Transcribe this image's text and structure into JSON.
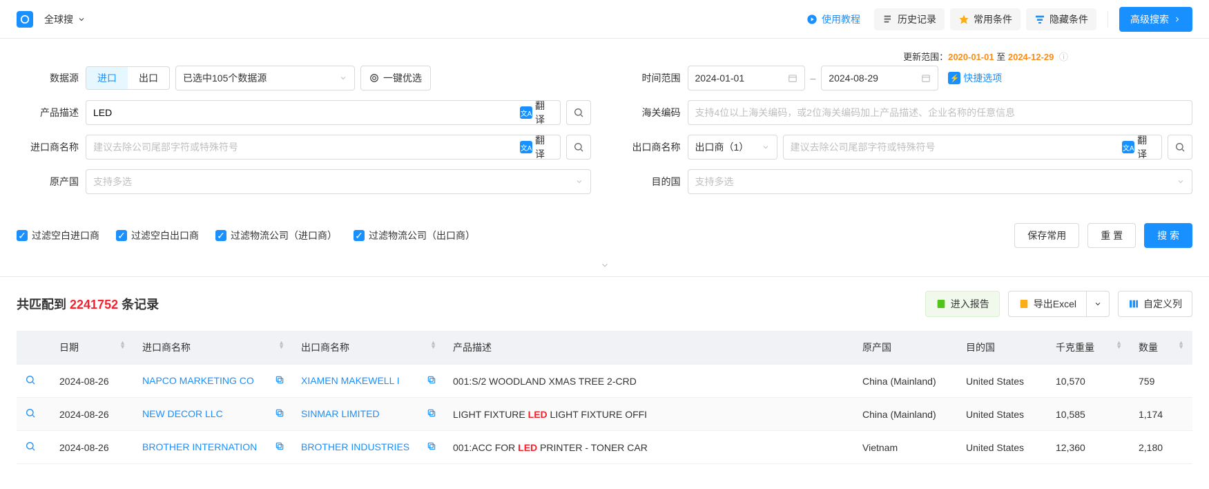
{
  "topbar": {
    "global_search": "全球搜",
    "tutorial": "使用教程",
    "history": "历史记录",
    "favorites": "常用条件",
    "hidden": "隐藏条件",
    "advanced": "高级搜索"
  },
  "update_range": {
    "label": "更新范围：",
    "from": "2020-01-01",
    "to_label": "至",
    "to": "2024-12-29"
  },
  "form": {
    "datasource_label": "数据源",
    "import_tab": "进口",
    "export_tab": "出口",
    "datasource_value": "已选中105个数据源",
    "optimize": "一键优选",
    "time_label": "时间范围",
    "date_from": "2024-01-01",
    "date_to": "2024-08-29",
    "quick_options": "快捷选项",
    "product_label": "产品描述",
    "product_value": "LED",
    "translate": "翻译",
    "hs_label": "海关编码",
    "hs_placeholder": "支持4位以上海关编码，或2位海关编码加上产品描述、企业名称的任意信息",
    "importer_label": "进口商名称",
    "importer_placeholder": "建议去除公司尾部字符或特殊符号",
    "exporter_label": "出口商名称",
    "exporter_value": "出口商（1）",
    "exporter_placeholder": "建议去除公司尾部字符或特殊符号",
    "origin_label": "原产国",
    "origin_placeholder": "支持多选",
    "dest_label": "目的国",
    "dest_placeholder": "支持多选"
  },
  "checks": {
    "c1": "过滤空白进口商",
    "c2": "过滤空白出口商",
    "c3": "过滤物流公司（进口商）",
    "c4": "过滤物流公司（出口商）"
  },
  "actions": {
    "save": "保存常用",
    "reset": "重 置",
    "search": "搜 索"
  },
  "results": {
    "prefix": "共匹配到 ",
    "count": "2241752",
    "suffix": " 条记录",
    "enter_report": "进入报告",
    "export_excel": "导出Excel",
    "custom_columns": "自定义列"
  },
  "table": {
    "headers": {
      "date": "日期",
      "importer": "进口商名称",
      "exporter": "出口商名称",
      "product": "产品描述",
      "origin": "原产国",
      "dest": "目的国",
      "weight": "千克重量",
      "qty": "数量"
    },
    "rows": [
      {
        "date": "2024-08-26",
        "importer": "NAPCO MARKETING CO",
        "exporter": "XIAMEN MAKEWELL I",
        "product_pre": "001:S/2 WOODLAND XMAS TREE 2-CRD",
        "product_hl": "",
        "product_post": "",
        "origin": "China (Mainland)",
        "dest": "United States",
        "weight": "10,570",
        "qty": "759"
      },
      {
        "date": "2024-08-26",
        "importer": "NEW DECOR LLC",
        "exporter": "SINMAR LIMITED",
        "product_pre": "LIGHT FIXTURE ",
        "product_hl": "LED",
        "product_post": " LIGHT FIXTURE OFFI",
        "origin": "China (Mainland)",
        "dest": "United States",
        "weight": "10,585",
        "qty": "1,174"
      },
      {
        "date": "2024-08-26",
        "importer": "BROTHER INTERNATION",
        "exporter": "BROTHER INDUSTRIES",
        "product_pre": "001:ACC FOR ",
        "product_hl": "LED",
        "product_post": " PRINTER - TONER CAR",
        "origin": "Vietnam",
        "dest": "United States",
        "weight": "12,360",
        "qty": "2,180"
      }
    ]
  }
}
